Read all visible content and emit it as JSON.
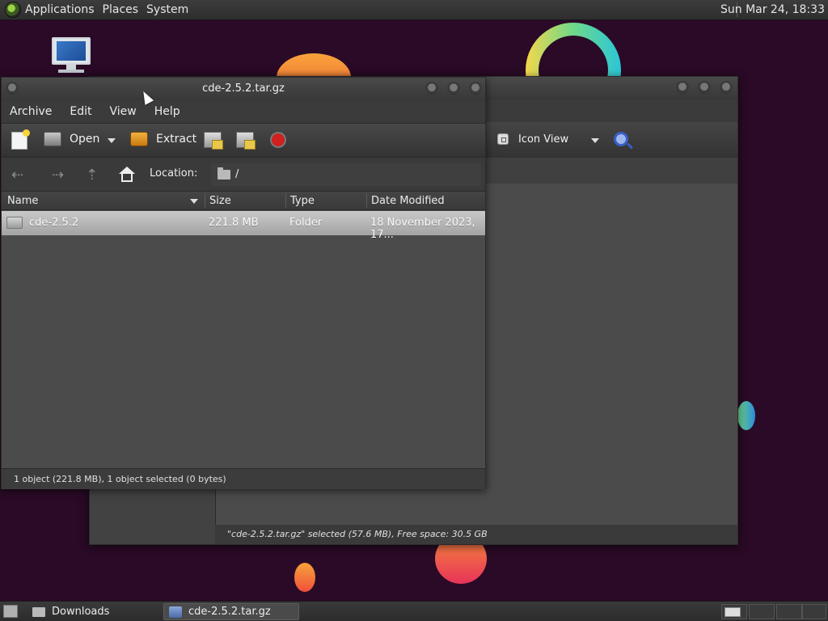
{
  "top_panel": {
    "menus": [
      "Applications",
      "Places",
      "System"
    ],
    "clock": "Sun Mar 24, 18:33"
  },
  "back_window": {
    "view_mode": "Icon View",
    "status": "\"cde-2.5.2.tar.gz\" selected (57.6 MB), Free space: 30.5 GB"
  },
  "archive_window": {
    "title": "cde-2.5.2.tar.gz",
    "menu": [
      "Archive",
      "Edit",
      "View",
      "Help"
    ],
    "toolbar": {
      "open_label": "Open",
      "extract_label": "Extract"
    },
    "location": {
      "label": "Location:",
      "value": "/"
    },
    "columns": [
      "Name",
      "Size",
      "Type",
      "Date Modified"
    ],
    "files": [
      {
        "name": "cde-2.5.2",
        "size": "221.8 MB",
        "type": "Folder",
        "modified": "18 November 2023, 17..."
      }
    ],
    "status": "1 object (221.8 MB), 1 object selected (0 bytes)"
  },
  "taskbar": {
    "tasks": [
      "Downloads",
      "cde-2.5.2.tar.gz"
    ]
  },
  "colors": {
    "wallpaper": "#2a0a26",
    "window_bg": "#4b4b4b",
    "selection": "#b6b6b6"
  }
}
